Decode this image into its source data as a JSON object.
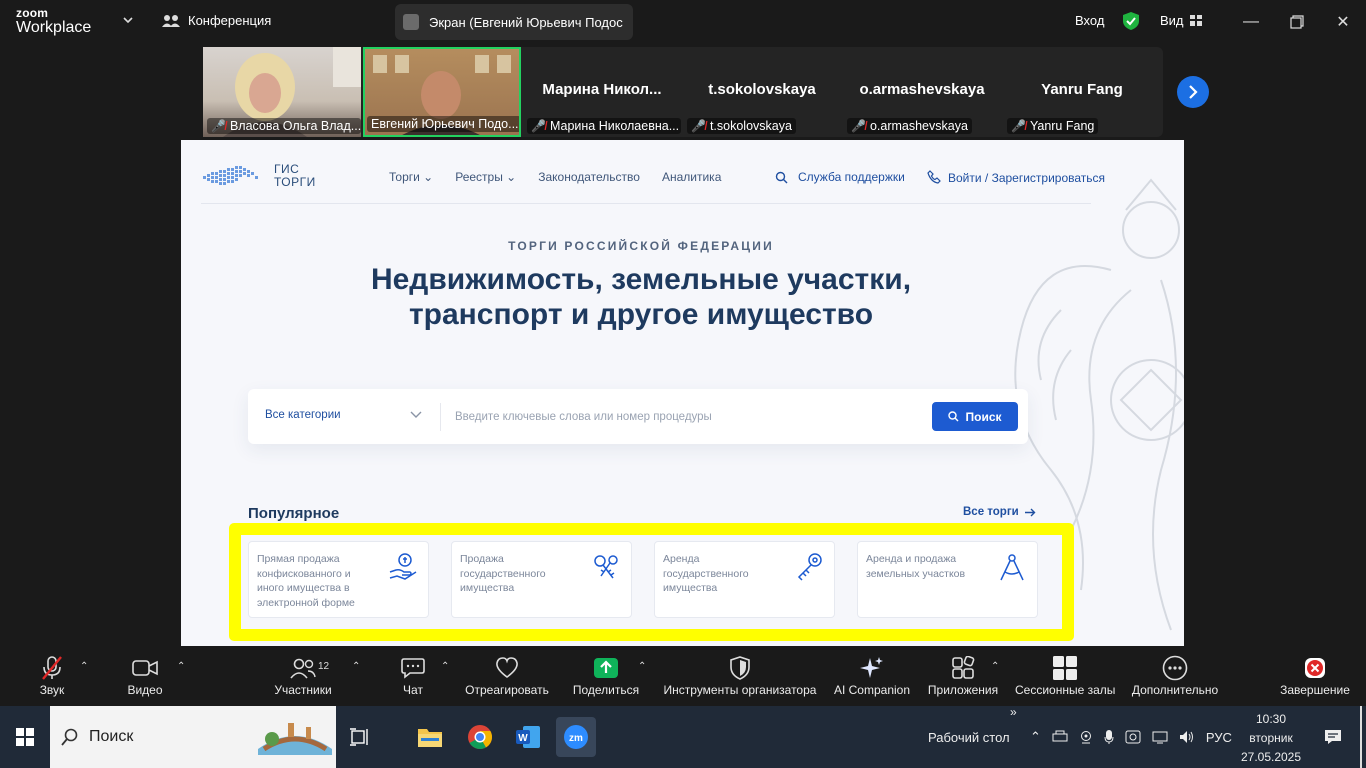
{
  "zoom": {
    "logo_top": "zoom",
    "logo_bottom": "Workplace",
    "conference_label": "Конференция",
    "screen_share_label": "Экран (Евгений Юрьевич Подос",
    "login_label": "Вход",
    "view_label": "Вид"
  },
  "participants": [
    {
      "name": "Власова Ольга Влад...",
      "has_video": true
    },
    {
      "name": "Евгений Юрьевич Подо...",
      "has_video": true,
      "active": true
    },
    {
      "display": "Марина  Никол...",
      "name": "Марина Николаевна...",
      "has_video": false
    },
    {
      "display": "t.sokolovskaya",
      "name": "t.sokolovskaya",
      "has_video": false
    },
    {
      "display": "o.armashevskaya",
      "name": "o.armashevskaya",
      "has_video": false
    },
    {
      "display": "Yanru Fang",
      "name": "Yanru Fang",
      "has_video": false
    }
  ],
  "site": {
    "logo_line1": "ГИС",
    "logo_line2": "ТОРГИ",
    "nav": [
      "Торги",
      "Реестры",
      "Законодательство",
      "Аналитика"
    ],
    "support": "Служба поддержки",
    "login": "Войти / Зарегистрироваться",
    "eyebrow": "ТОРГИ РОССИЙСКОЙ ФЕДЕРАЦИИ",
    "hero_line1": "Недвижимость, земельные участки,",
    "hero_line2": "транспорт и другое имущество",
    "search": {
      "category": "Все категории",
      "placeholder": "Введите ключевые слова или номер процедуры",
      "button": "Поиск"
    },
    "popular_title": "Популярное",
    "all_torgi": "Все торги",
    "cards": [
      {
        "text": "Прямая продажа конфискованного и иного имущества в электронной форме",
        "icon": "hand-coin-icon"
      },
      {
        "text": "Продажа государственного имущества",
        "icon": "keys-icon"
      },
      {
        "text": "Аренда государственного имущества",
        "icon": "key-icon"
      },
      {
        "text": "Аренда и продажа земельных участков",
        "icon": "compass-icon"
      }
    ],
    "highlight_color": "#ffff00"
  },
  "toolbar": {
    "audio": "Звук",
    "video": "Видео",
    "participants": "Участники",
    "participants_count": "12",
    "chat": "Чат",
    "react": "Отреагировать",
    "share": "Поделиться",
    "host_tools": "Инструменты организатора",
    "ai": "AI Companion",
    "apps": "Приложения",
    "breakout": "Сессионные залы",
    "more": "Дополнительно",
    "end": "Завершение"
  },
  "taskbar": {
    "search_label": "Поиск",
    "desktop_label": "Рабочий стол",
    "lang": "РУС",
    "time": "10:30",
    "weekday": "вторник",
    "date": "27.05.2025"
  },
  "colors": {
    "zoom_bg": "#1a1a1a",
    "share_green": "#0fb35a",
    "site_blue": "#1d5bd1",
    "end_red": "#e02828"
  }
}
